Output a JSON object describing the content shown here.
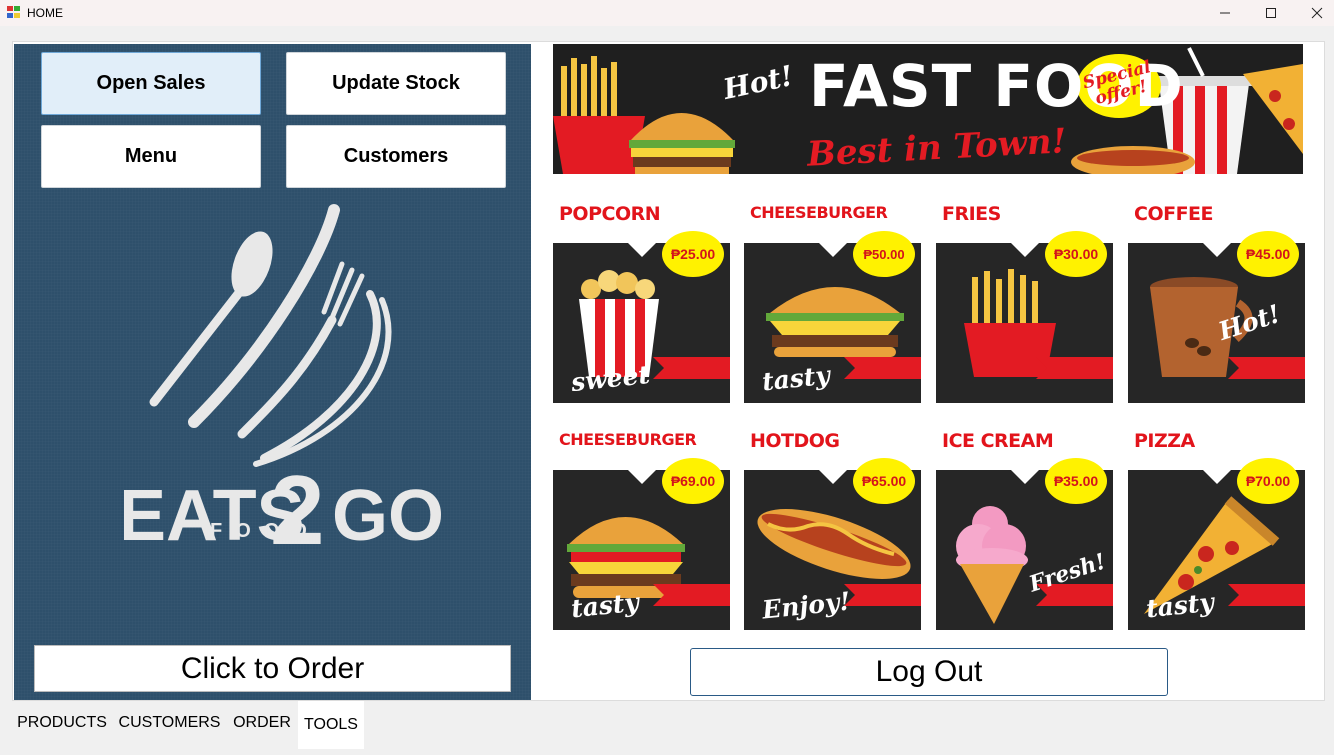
{
  "window": {
    "title": "HOME"
  },
  "left_panel": {
    "buttons": {
      "open_sales": "Open Sales",
      "update_stock": "Update Stock",
      "menu": "Menu",
      "customers": "Customers"
    },
    "logo": {
      "brand_left": "EATS",
      "brand_mid": "2",
      "brand_right": "GO",
      "tagline": "FOOD"
    },
    "order_button": "Click to Order"
  },
  "banner": {
    "hot": "Hot!",
    "title": "FAST FOOD",
    "tagline": "Best in Town!",
    "badge": "Special offer!"
  },
  "menu_items": [
    {
      "name": "POPCORN",
      "price": "₱25.00",
      "script": "sweet"
    },
    {
      "name": "CHEESEBURGER",
      "price": "₱50.00",
      "script": "tasty"
    },
    {
      "name": "FRIES",
      "price": "₱30.00",
      "script": ""
    },
    {
      "name": "COFFEE",
      "price": "₱45.00",
      "script": "Hot!"
    },
    {
      "name": "CHEESEBURGER",
      "price": "₱69.00",
      "script": "tasty"
    },
    {
      "name": "HOTDOG",
      "price": "₱65.00",
      "script": "Enjoy!"
    },
    {
      "name": "ICE CREAM",
      "price": "₱35.00",
      "script": "Fresh!"
    },
    {
      "name": "PIZZA",
      "price": "₱70.00",
      "script": "tasty"
    }
  ],
  "logout_button": "Log Out",
  "tabs": [
    {
      "label": "PRODUCTS"
    },
    {
      "label": "CUSTOMERS"
    },
    {
      "label": "ORDER"
    },
    {
      "label": "TOOLS",
      "selected": true
    }
  ],
  "colors": {
    "panel": "#2e506b",
    "accent_red": "#e31b23",
    "price_yellow": "#fff200",
    "active_button": "#e1eef9"
  }
}
